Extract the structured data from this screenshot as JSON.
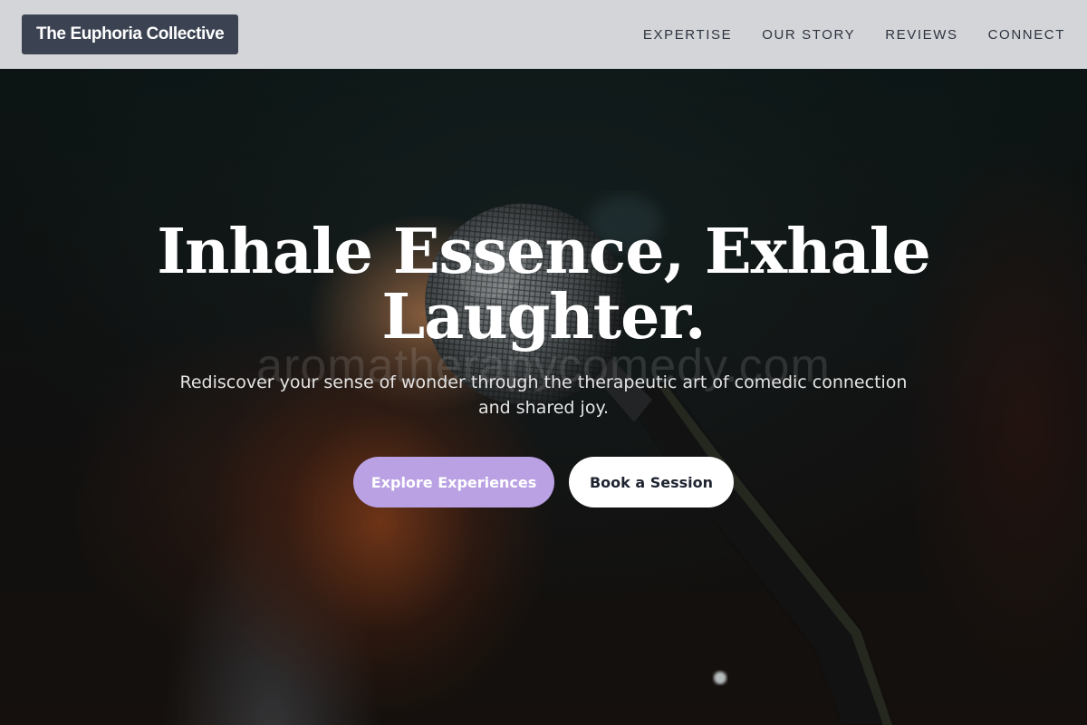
{
  "header": {
    "logo_text": "The Euphoria Collective",
    "nav": [
      {
        "label": "EXPERTISE"
      },
      {
        "label": "OUR STORY"
      },
      {
        "label": "REVIEWS"
      },
      {
        "label": "CONNECT"
      }
    ]
  },
  "hero": {
    "watermark": "aromatherapycomedy.com",
    "title_line1": "Inhale Essence, Exhale",
    "title_line2": "Laughter.",
    "subtitle": "Rediscover your sense of wonder through the therapeutic art of comedic connection and shared joy.",
    "primary_button": "Explore Experiences",
    "secondary_button": "Book a Session",
    "background_image": "microphone-photo"
  },
  "colors": {
    "header_bg": "#d3d5d8",
    "logo_bg": "#3b4352",
    "primary_button_bg": "#b9a1e3",
    "secondary_button_bg": "#ffffff"
  }
}
